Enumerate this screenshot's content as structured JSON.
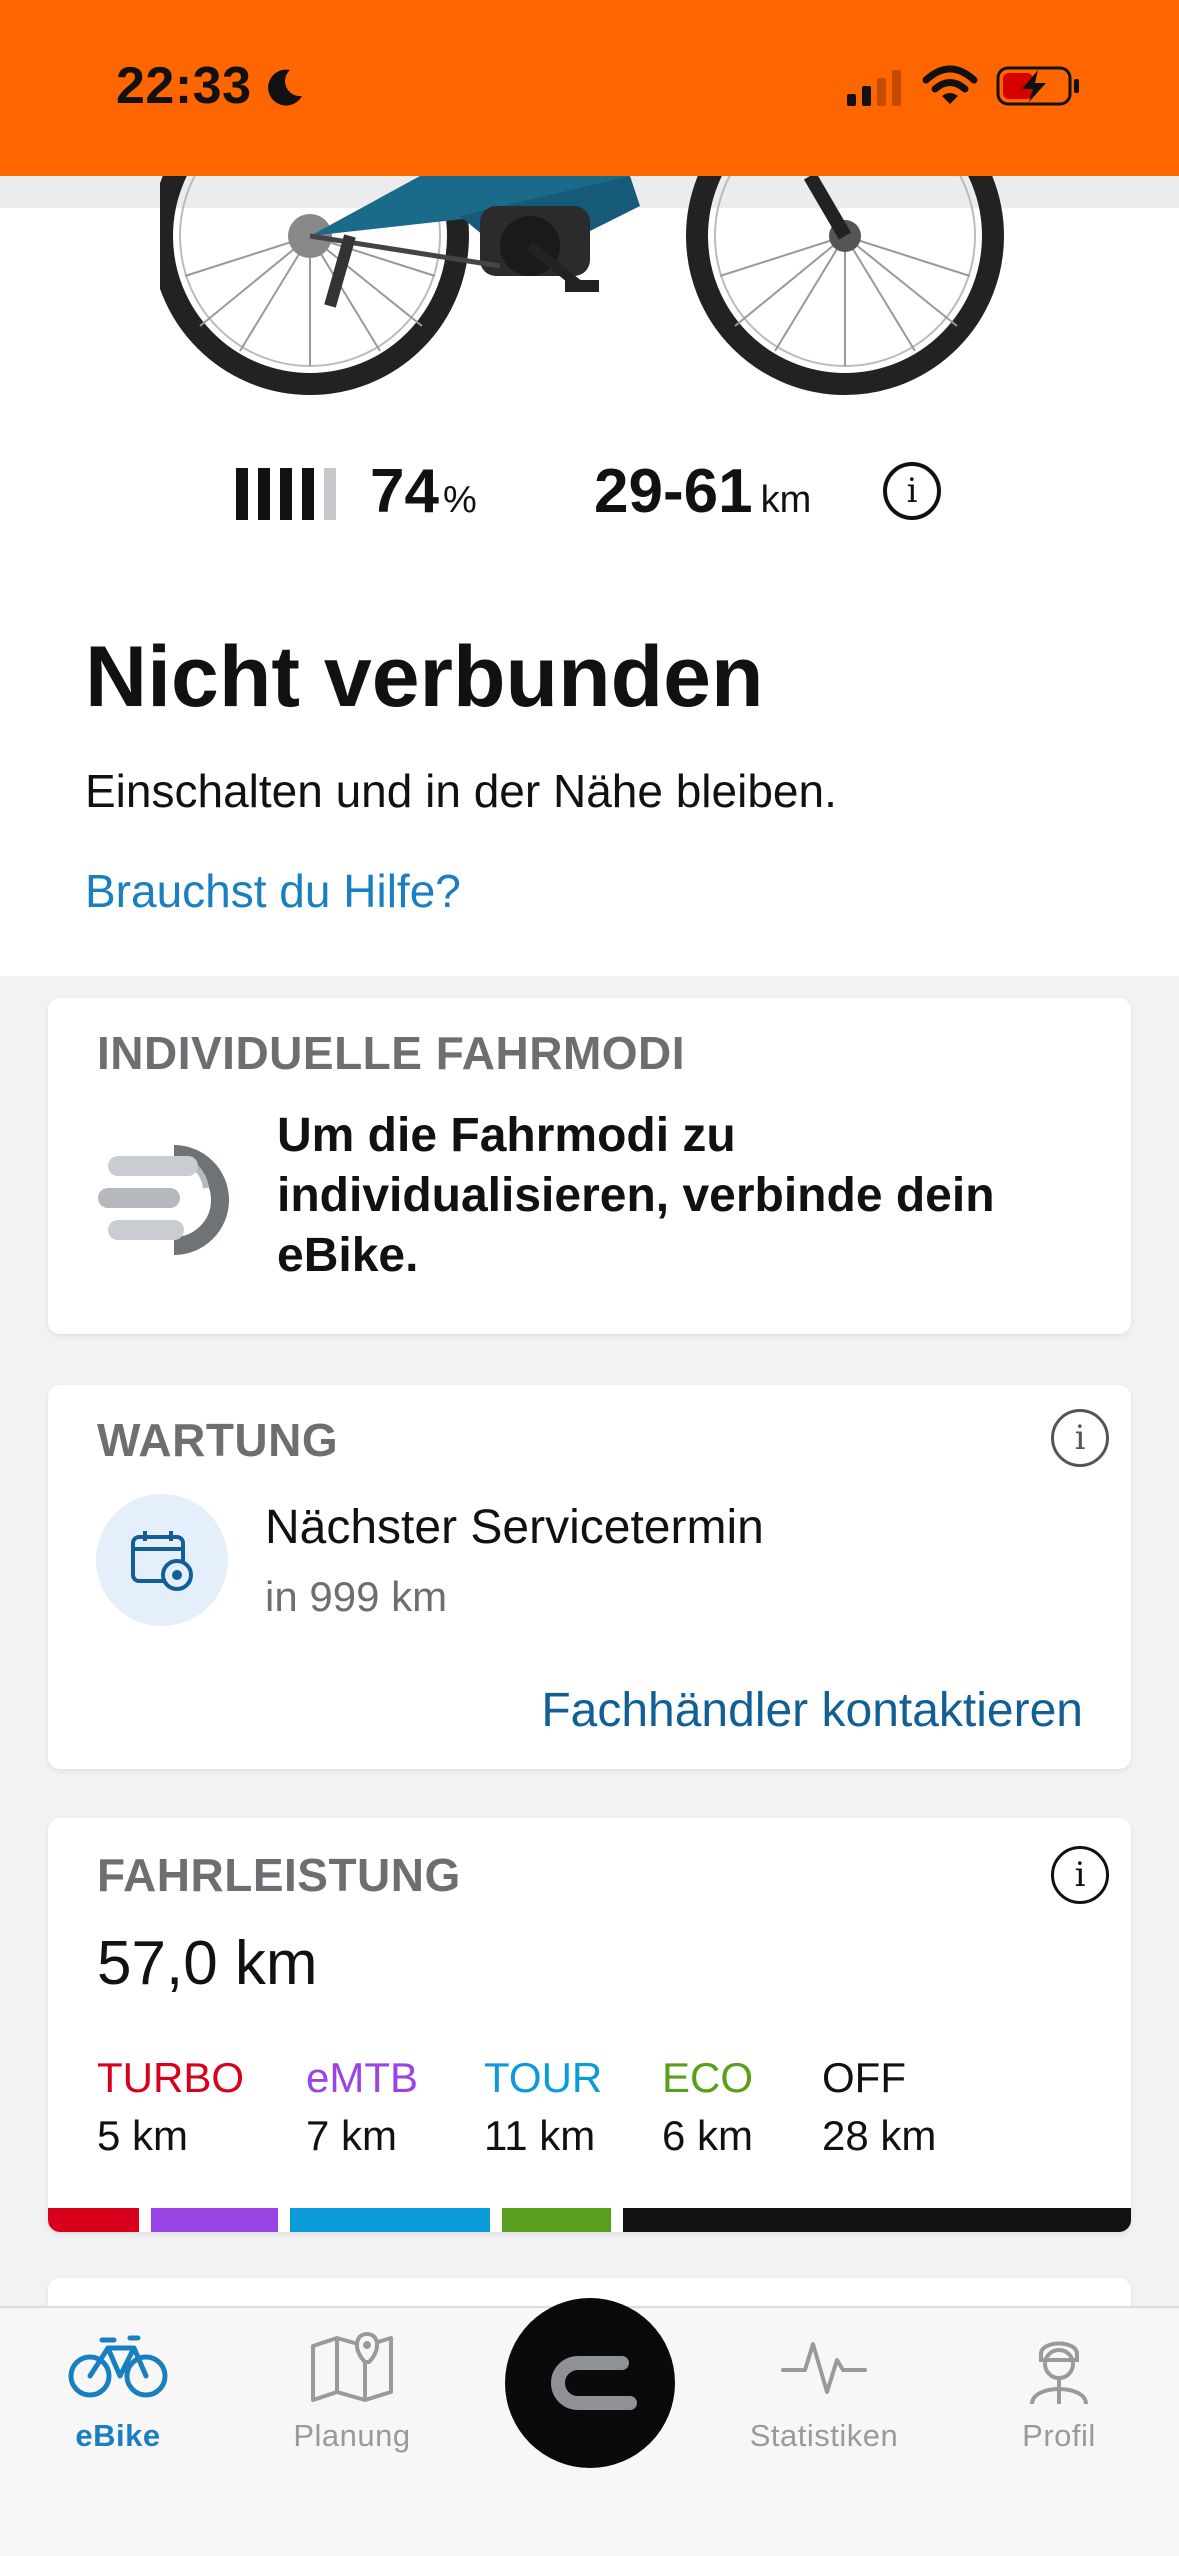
{
  "status_bar": {
    "time": "22:33",
    "focus_icon": "moon-icon",
    "signal_icon": "cellular-signal-icon",
    "wifi_icon": "wifi-icon",
    "battery_icon": "battery-charging-icon"
  },
  "colors": {
    "brand_orange": "#ff6600",
    "link_blue": "#1a7fc1",
    "dark_link_blue": "#125f96",
    "turbo": "#d9001b",
    "emtb": "#9b44e6",
    "tour": "#0a9bd8",
    "eco": "#5a9e1d",
    "off": "#111111"
  },
  "ebike": {
    "battery_percent": "74",
    "battery_unit": "%",
    "battery_level": 0.8,
    "range": "29-61",
    "range_unit": "km",
    "info_label": "i"
  },
  "connection": {
    "title": "Nicht verbunden",
    "subtitle": "Einschalten und in der Nähe bleiben.",
    "help_link": "Brauchst du Hilfe?"
  },
  "riding_modes_card": {
    "title": "INDIVIDUELLE FAHRMODI",
    "text": "Um die Fahrmodi zu individualisieren, verbinde dein eBike."
  },
  "maintenance_card": {
    "title": "WARTUNG",
    "info_label": "i",
    "service_title": "Nächster Servicetermin",
    "service_sub": "in 999 km",
    "dealer_link": "Fachhändler kontaktieren"
  },
  "performance_card": {
    "title": "FAHRLEISTUNG",
    "info_label": "i",
    "total": "57,0 km",
    "modes": [
      {
        "name": "TURBO",
        "km": "5 km",
        "value": 5
      },
      {
        "name": "eMTB",
        "km": "7 km",
        "value": 7
      },
      {
        "name": "TOUR",
        "km": "11 km",
        "value": 11
      },
      {
        "name": "ECO",
        "km": "6 km",
        "value": 6
      },
      {
        "name": "OFF",
        "km": "28 km",
        "value": 28
      }
    ]
  },
  "tab_bar": {
    "tabs": [
      {
        "label": "eBike",
        "active": true
      },
      {
        "label": "Planung",
        "active": false
      },
      {
        "label": "Statistiken",
        "active": false
      },
      {
        "label": "Profil",
        "active": false
      }
    ]
  }
}
